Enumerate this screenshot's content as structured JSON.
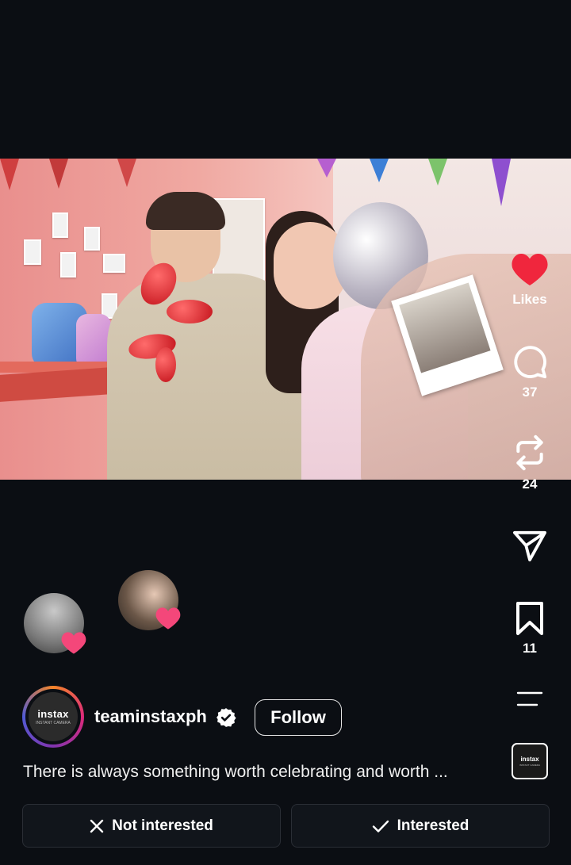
{
  "post": {
    "username": "teaminstaxph",
    "follow_label": "Follow",
    "caption": "There is always something worth celebrating and worth ...",
    "logo_text": "instax",
    "logo_subtext": "INSTANT CAMERA"
  },
  "rail": {
    "likes_label": "Likes",
    "comments_count": "37",
    "reposts_count": "24",
    "saves_count": "11"
  },
  "feedback": {
    "not_interested_label": "Not interested",
    "interested_label": "Interested"
  },
  "icons": {
    "like": "heart-icon",
    "comment": "comment-icon",
    "repost": "repost-icon",
    "share": "send-icon",
    "save": "bookmark-icon",
    "more": "menu-lines-icon",
    "verified": "verified-badge-icon",
    "close": "close-icon",
    "check": "check-icon"
  },
  "colors": {
    "background": "#0b0e13",
    "like": "#f0263d",
    "button_bg": "#11151b"
  }
}
